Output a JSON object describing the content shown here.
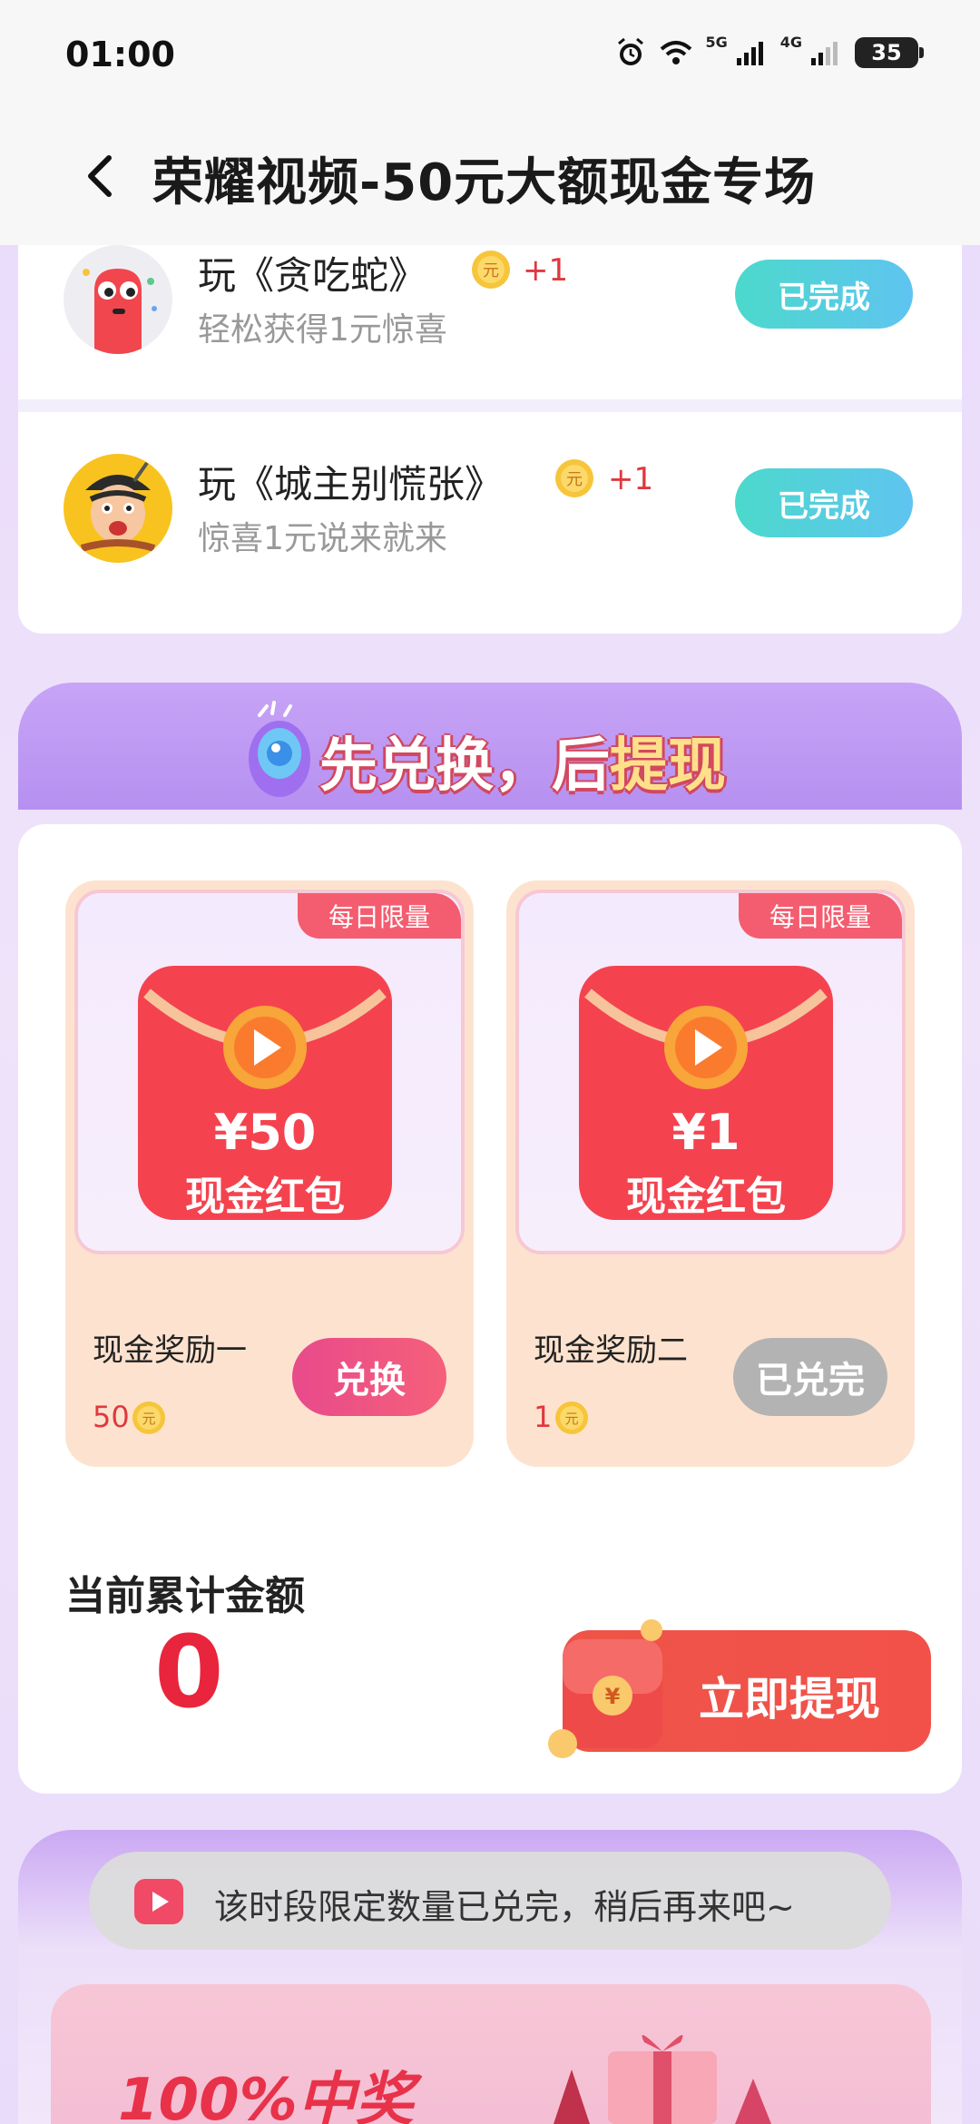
{
  "status_bar": {
    "time": "01:00",
    "signal_5g": "5G",
    "signal_4g": "4G",
    "battery": "35"
  },
  "header": {
    "title": "荣耀视频-50元大额现金专场"
  },
  "tasks": [
    {
      "title": "玩《贪吃蛇》",
      "reward": "+1",
      "subtitle": "轻松获得1元惊喜",
      "button": "已完成",
      "coin_glyph": "元"
    },
    {
      "title": "玩《城主别慌张》",
      "reward": "+1",
      "subtitle": "惊喜1元说来就来",
      "button": "已完成",
      "coin_glyph": "元"
    }
  ],
  "banner": {
    "part1": "先兑换，后",
    "part2": "提现"
  },
  "rewards": [
    {
      "tag": "每日限量",
      "amount": "¥50",
      "label": "现金红包",
      "name": "现金奖励一",
      "cost": "50",
      "button": "兑换",
      "enabled": true
    },
    {
      "tag": "每日限量",
      "amount": "¥1",
      "label": "现金红包",
      "name": "现金奖励二",
      "cost": "1",
      "button": "已兑完",
      "enabled": false
    }
  ],
  "total": {
    "label": "当前累计金额",
    "value": "0",
    "withdraw_button": "立即提现"
  },
  "toast": {
    "text": "该时段限定数量已兑完，稍后再来吧~"
  },
  "prize_banner": {
    "text": "100%中奖"
  },
  "colors": {
    "accent_red": "#e8253c",
    "done_teal": "#4cd9cc",
    "exchange_pink": "#e84a8b"
  }
}
